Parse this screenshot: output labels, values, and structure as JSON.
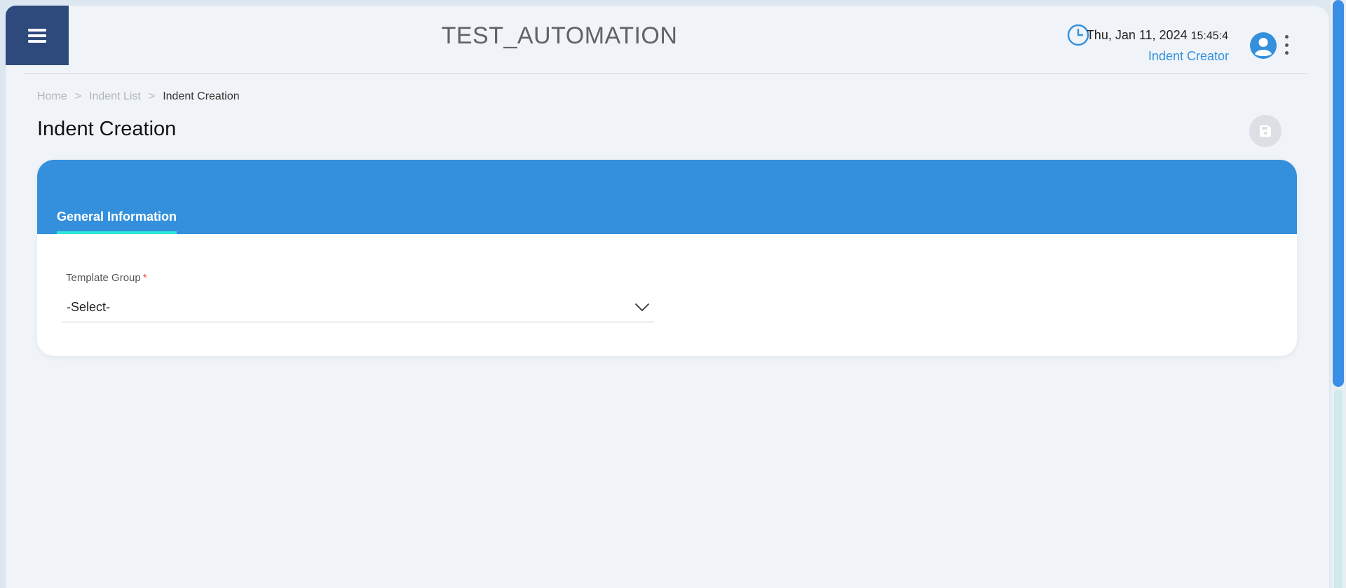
{
  "header": {
    "app_title": "TEST_AUTOMATION",
    "date": "Thu, Jan 11, 2024",
    "time": "15:45:4",
    "user_role": "Indent Creator",
    "icons": [
      "menu-icon",
      "clock-icon",
      "user-avatar-icon",
      "more-vert-icon"
    ]
  },
  "breadcrumb": {
    "items": [
      "Home",
      "Indent List",
      "Indent Creation"
    ],
    "separator": ">"
  },
  "page": {
    "title": "Indent Creation",
    "save_icon": "save-icon"
  },
  "form": {
    "tabs": [
      {
        "label": "General Information",
        "active": true
      }
    ],
    "fields": [
      {
        "label": "Template Group",
        "required_marker": "*",
        "value": "-Select-"
      }
    ]
  },
  "colors": {
    "nav_dark": "#2e4a7d",
    "accent_blue": "#3490dc",
    "tab_underline": "#2ee6d6",
    "required": "#e74c3c",
    "background": "#f0f4f8"
  }
}
